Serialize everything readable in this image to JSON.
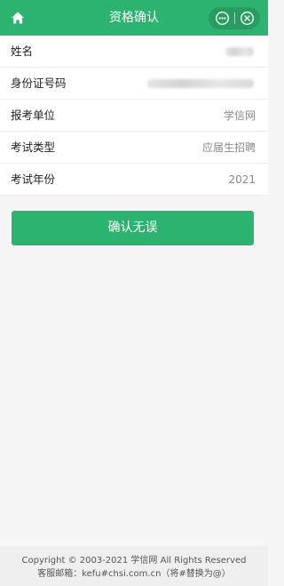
{
  "header": {
    "title": "资格确认"
  },
  "form": {
    "rows": [
      {
        "label": "姓名",
        "value": ""
      },
      {
        "label": "身份证号码",
        "value": ""
      },
      {
        "label": "报考单位",
        "value": "学信网"
      },
      {
        "label": "考试类型",
        "value": "应届生招聘"
      },
      {
        "label": "考试年份",
        "value": "2021"
      }
    ]
  },
  "confirm_button": {
    "label": "确认无误"
  },
  "footer": {
    "copyright": "Copyright © 2003-2021 学信网 All Rights Reserved",
    "contact": "客服邮箱：kefu#chsi.com.cn（将#替换为@）"
  },
  "colors": {
    "accent": "#2db370"
  },
  "icons": {
    "home": "home-icon",
    "more": "more-icon",
    "close": "close-icon"
  }
}
